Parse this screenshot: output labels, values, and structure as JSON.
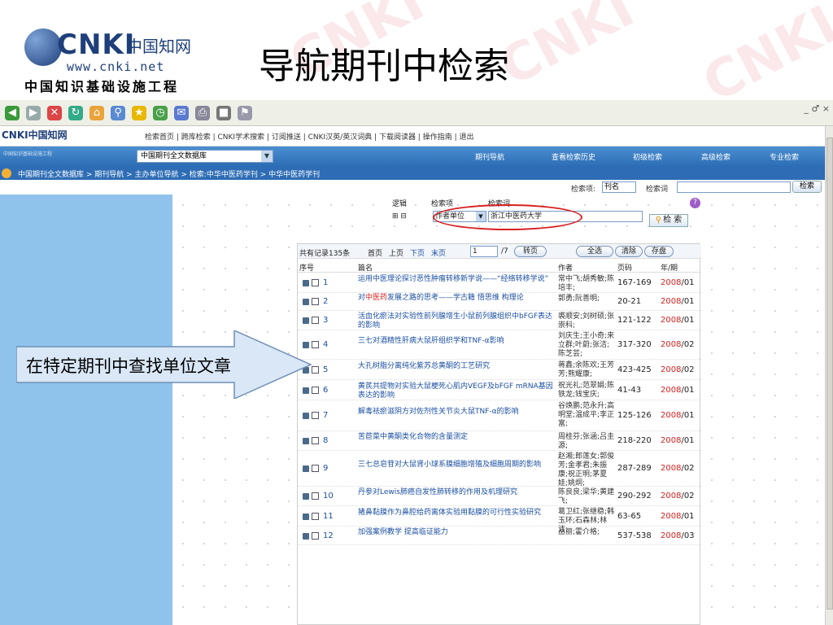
{
  "slide": {
    "title": "导航期刊中检索",
    "logo_brand": "CNKI",
    "logo_cn": "中国知网",
    "logo_url": "www.cnki.net",
    "logo_sub": "中国知识基础设施工程",
    "watermark": "CNKI",
    "callout": "在特定期刊中查找单位文章"
  },
  "browser": {
    "window_controls": "_ ♂ ×"
  },
  "topnav": {
    "logo": "CNKI中国知网",
    "links": "检索首页 | 跨库检索 | CNKI学术搜索 | 订阅推送 | CNKI汉英/英汉词典 | 下载阅读器 | 操作指南 | 退出"
  },
  "bluebar": {
    "label": "中国知识基础设施工程",
    "db_value": "中国期刊全文数据库",
    "tabs": [
      "期刊导航",
      "查看检索历史",
      "初级检索",
      "高级检索",
      "专业检索"
    ]
  },
  "breadcrumb": "中国期刊全文数据库 > 期刊导航 > 主办单位导航 > 检索:中华中医药学刊 > 中华中医药学刊",
  "quicksearch": {
    "field_label": "检索项:",
    "field_value": "刊名",
    "term_label": "检索词",
    "button": "检索"
  },
  "form": {
    "logic_label": "逻辑",
    "field_label": "检索项",
    "term_label": "检索词",
    "logic_buttons": "⊞ ⊟",
    "field_value": "作者单位",
    "term_value": "浙江中医药大学",
    "button": "检 索"
  },
  "pager": {
    "total": "共有记录135条",
    "first": "首页",
    "prev": "上页",
    "next": "下页",
    "last": "末页",
    "page": "1",
    "of": "/7",
    "go": "转页",
    "select_all": "全选",
    "clear": "清除",
    "save": "存盘"
  },
  "columns": [
    "序号",
    "篇名",
    "作者",
    "页码",
    "年/期"
  ],
  "rows": [
    {
      "no": "1",
      "title": "运用中医理论探讨恶性肿瘤转移新学说——“经络转移学说”",
      "author": "常中飞;胡秀敏;陈培丰;",
      "pages": "167-169",
      "year": "2008",
      "issue": "/01"
    },
    {
      "no": "2",
      "title": "对中医药发展之路的思考——学古籍 悟思维 构理论",
      "author": "郭勇;阮善明;",
      "pages": "20-21",
      "year": "2008",
      "issue": "/01"
    },
    {
      "no": "3",
      "title": "活血化瘀法对实验性前列腺增生小鼠前列腺组织中bFGF表达的影响",
      "author": "裘顺安;刘树硕;张崇科;",
      "pages": "121-122",
      "year": "2008",
      "issue": "/01"
    },
    {
      "no": "4",
      "title": "三七对酒精性肝病大鼠肝组织学和TNF-α影响",
      "author": "刘庆生;王小奇;来立群;叶蔚;张洁;陈芝芸;",
      "pages": "317-320",
      "year": "2008",
      "issue": "/02"
    },
    {
      "no": "5",
      "title": "大孔树脂分离纯化紫苏总黄酮的工艺研究",
      "author": "蒋鑫;余陈欢;王芳芳;熊耀康;",
      "pages": "423-425",
      "year": "2008",
      "issue": "/02"
    },
    {
      "no": "6",
      "title": "黄芪共提物对实验大鼠梗死心肌内VEGF及bFGF mRNA基因表达的影响",
      "author": "祝光礼;范翠娟;陈铁龙;钱宝庆;",
      "pages": "41-43",
      "year": "2008",
      "issue": "/01"
    },
    {
      "no": "7",
      "title": "解毒祛瘀滋阴方对佐剂性关节炎大鼠TNF-α的影响",
      "author": "谷焕鹏;范永升;高明堂;温成平;李正富;",
      "pages": "125-126",
      "year": "2008",
      "issue": "/01"
    },
    {
      "no": "8",
      "title": "苦苣菜中黄酮类化合物的含量测定",
      "author": "周桂芬;张涵;吕圭源;",
      "pages": "218-220",
      "year": "2008",
      "issue": "/01"
    },
    {
      "no": "9",
      "title": "三七总皂苷对大鼠肾小球系膜细胞增殖及细胞周期的影响",
      "author": "赵湘;郎莲女;郭俊芳;金孝君;朱振康;祝正明;茅夏娃;姚炯;",
      "pages": "287-289",
      "year": "2008",
      "issue": "/02"
    },
    {
      "no": "10",
      "title": "丹参对Lewis肺癌自发性肺转移的作用及机理研究",
      "author": "陈良良;梁华;黄建飞;",
      "pages": "290-292",
      "year": "2008",
      "issue": "/02"
    },
    {
      "no": "11",
      "title": "猪鼻黏膜作为鼻腔给药离体实验用黏膜的可行性实验研究",
      "author": "葛卫红;张继稳;韩玉环;石森林;林洁;",
      "pages": "63-65",
      "year": "2008",
      "issue": "/01"
    },
    {
      "no": "12",
      "title": "加强案例教学 提高临证能力",
      "author": "丛丽;霍介格;",
      "pages": "537-538",
      "year": "2008",
      "issue": "/03"
    }
  ],
  "colors": {
    "accent_blue": "#2c6cb4",
    "left_panel": "#8fc3ec",
    "highlight_red": "#d81e1e",
    "oval": "#d82020"
  }
}
